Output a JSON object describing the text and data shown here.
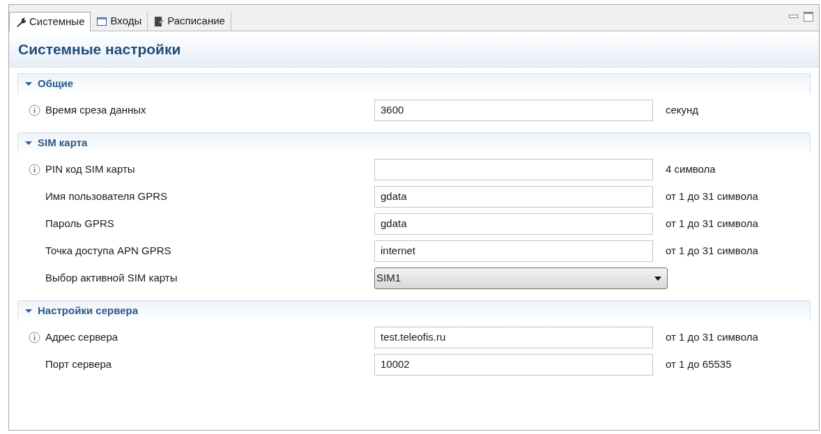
{
  "tabs": [
    {
      "label": "Системные",
      "selected": true
    },
    {
      "label": "Входы",
      "selected": false
    },
    {
      "label": "Расписание",
      "selected": false
    }
  ],
  "title": "Системные настройки",
  "sections": [
    {
      "title": "Общие",
      "expanded": true,
      "rows": [
        {
          "kind": "text",
          "info": true,
          "label": "Время среза данных",
          "value": "3600",
          "hint": "секунд"
        }
      ]
    },
    {
      "title": "SIM карта",
      "expanded": true,
      "rows": [
        {
          "kind": "text",
          "info": true,
          "label": "PIN код SIM карты",
          "hint": "4 символа"
        },
        {
          "kind": "text",
          "info": false,
          "label": "Имя пользователя GPRS",
          "value": "gdata",
          "hint": "от 1 до 31 символа"
        },
        {
          "kind": "text",
          "info": false,
          "label": "Пароль GPRS",
          "value": "gdata",
          "hint": "от 1 до 31 символа"
        },
        {
          "kind": "text",
          "info": false,
          "label": "Точка доступа APN GPRS",
          "value": "internet",
          "hint": "от 1 до 31 символа"
        },
        {
          "kind": "select",
          "info": false,
          "label": "Выбор активной SIM карты",
          "value": "SIM1"
        }
      ]
    },
    {
      "title": "Настройки сервера",
      "expanded": true,
      "rows": [
        {
          "kind": "text",
          "info": true,
          "label": "Адрес сервера",
          "value": "test.teleofis.ru",
          "hint": "от 1 до 31 символа"
        },
        {
          "kind": "text",
          "info": false,
          "label": "Порт сервера",
          "value": "10002",
          "hint": "от 1 до 65535"
        }
      ]
    }
  ]
}
